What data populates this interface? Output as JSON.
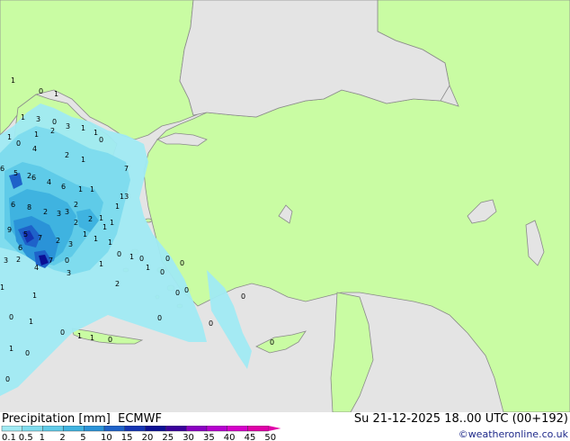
{
  "header": {
    "product_label": "Precipitation [mm]",
    "model": "ECMWF",
    "valid_time": "Su 21-12-2025 18..00 UTC (00+192)"
  },
  "credit": "©weatheronline.co.uk",
  "legend": {
    "ticks": [
      "0.1",
      "0.5",
      "1",
      "2",
      "5",
      "10",
      "15",
      "20",
      "25",
      "30",
      "35",
      "40",
      "45",
      "50"
    ],
    "colors": [
      "#a0eaf3",
      "#7fdcee",
      "#5fcbe8",
      "#3fb3e0",
      "#2a93d8",
      "#1e62c9",
      "#1434b3",
      "#0b0f94",
      "#3a009b",
      "#8a00c2",
      "#b600cf",
      "#d600c9",
      "#e000a8"
    ]
  },
  "colors": {
    "land": "#c9fca3",
    "sea": "#e4e4e4",
    "border": "#9a9a9a"
  },
  "map_labels": [
    "1",
    "3",
    "1",
    "0",
    "1",
    "1",
    "0",
    "1",
    "0",
    "2",
    "6",
    "4",
    "3",
    "2",
    "1",
    "0",
    "2",
    "1",
    "1",
    "7",
    "5",
    "6",
    "4",
    "6",
    "1",
    "1",
    "13",
    "8",
    "6",
    "2",
    "2",
    "3",
    "3",
    "2",
    "1",
    "1",
    "9",
    "2",
    "1",
    "1",
    "3",
    "1",
    "2",
    "1",
    "1",
    "7",
    "6",
    "7",
    "3",
    "5",
    "0",
    "3",
    "4",
    "2",
    "0",
    "0",
    "1",
    "0",
    "0",
    "1",
    "2",
    "1",
    "0",
    "1",
    "0",
    "0",
    "1",
    "0",
    "0",
    "0",
    "0",
    "1",
    "0",
    "0",
    "1",
    "1",
    "0",
    "1",
    "0",
    "0"
  ]
}
